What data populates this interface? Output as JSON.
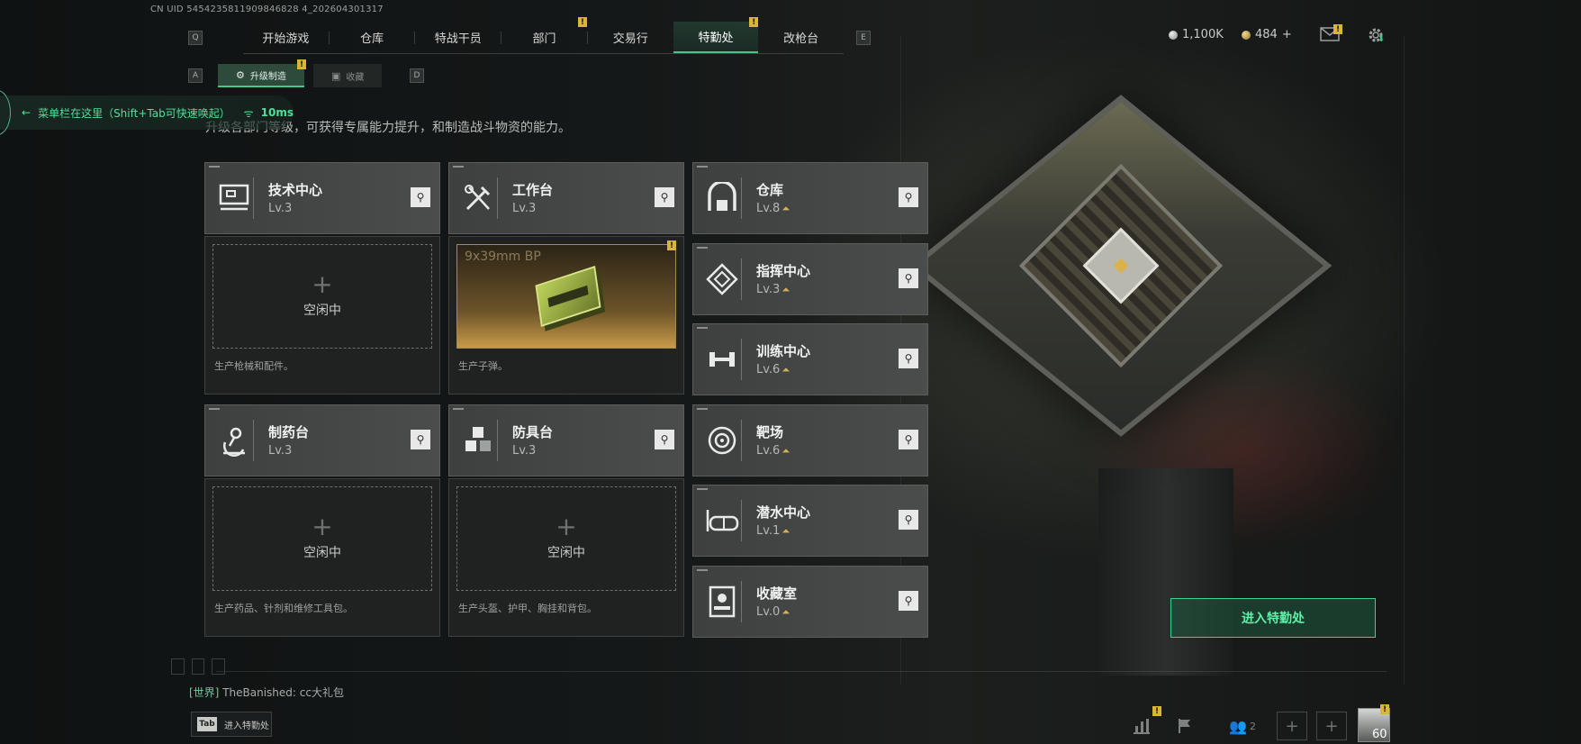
{
  "uid": "CN UID 5454235811909846828 4_202604301317",
  "nav": {
    "left_key": "Q",
    "right_key": "E",
    "items": [
      "开始游戏",
      "仓库",
      "特战干员",
      "部门",
      "交易行",
      "特勤处",
      "改枪台"
    ],
    "badge": "!"
  },
  "currency": {
    "silver": "1,100K",
    "gold": "484",
    "gold_plus": "+"
  },
  "subtabs": {
    "left_key": "A",
    "right_key": "D",
    "upgrade": "升级制造",
    "collect": "收藏"
  },
  "hint": {
    "text": "菜单栏在这里（Shift+Tab可快速唤起）",
    "ping": "10ms"
  },
  "description": "升级各部门等级，可获得专属能力提升，和制造战斗物资的能力。",
  "departments": {
    "tech": {
      "name": "技术中心",
      "level": "Lv.3"
    },
    "workbench": {
      "name": "工作台",
      "level": "Lv.3"
    },
    "warehouse": {
      "name": "仓库",
      "level": "Lv.8"
    },
    "command": {
      "name": "指挥中心",
      "level": "Lv.3"
    },
    "training": {
      "name": "训练中心",
      "level": "Lv.6"
    },
    "range": {
      "name": "靶场",
      "level": "Lv.6"
    },
    "pharma": {
      "name": "制药台",
      "level": "Lv.3"
    },
    "armor": {
      "name": "防具台",
      "level": "Lv.3"
    },
    "diving": {
      "name": "潜水中心",
      "level": "Lv.1"
    },
    "collection": {
      "name": "收藏室",
      "level": "Lv.0"
    }
  },
  "slots": {
    "idle": "空闲中",
    "tech_desc": "生产枪械和配件。",
    "workbench_item": "9x39mm BP",
    "workbench_desc": "生产子弹。",
    "pharma_desc": "生产药品、针剂和维修工具包。",
    "armor_desc": "生产头盔、护甲、胸挂和背包。"
  },
  "enter_button": "进入特勤处",
  "chat": {
    "channel": "[世界]",
    "message": "TheBanished: cc大礼包"
  },
  "bottom": {
    "tab_key": "Tab",
    "tab_label": "进入特勤处",
    "friends_count": "2",
    "level": "60"
  },
  "colors": {
    "accent_green": "#43c88b",
    "badge_yellow": "#d9b634",
    "upgrade_gold": "#d6b05c"
  }
}
